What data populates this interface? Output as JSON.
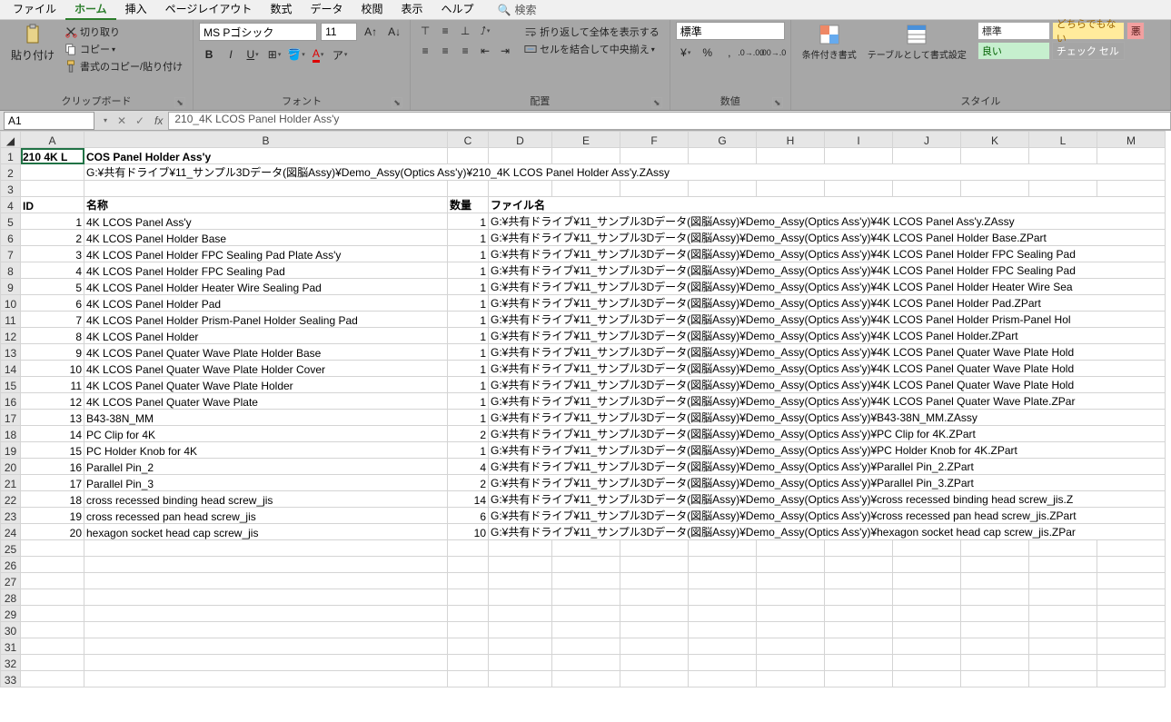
{
  "menu": {
    "items": [
      "ファイル",
      "ホーム",
      "挿入",
      "ページレイアウト",
      "数式",
      "データ",
      "校閲",
      "表示",
      "ヘルプ"
    ],
    "active": 1,
    "search_icon": "🔍",
    "search_label": "検索"
  },
  "ribbon": {
    "clipboard": {
      "label": "クリップボード",
      "paste": "貼り付け",
      "cut": "切り取り",
      "copy": "コピー",
      "format_painter": "書式のコピー/貼り付け"
    },
    "font": {
      "label": "フォント",
      "name": "MS Pゴシック",
      "size": "11"
    },
    "alignment": {
      "label": "配置",
      "wrap": "折り返して全体を表示する",
      "merge": "セルを結合して中央揃え"
    },
    "number": {
      "label": "数値",
      "format": "標準"
    },
    "styles": {
      "label": "スタイル",
      "cond_fmt": "条件付き書式",
      "table_fmt": "テーブルとして書式設定",
      "normal": "標準",
      "neutral": "どちらでもない",
      "good": "良い",
      "check": "チェック セル",
      "bad": "悪"
    }
  },
  "formula_bar": {
    "cell_ref": "A1",
    "formula": "210_4K LCOS Panel Holder Ass'y"
  },
  "sheet": {
    "col_headers": [
      "A",
      "B",
      "C",
      "D",
      "E",
      "F",
      "G",
      "H",
      "I",
      "J",
      "K",
      "L",
      "M"
    ],
    "title_row": {
      "a": "210 4K L",
      "b_spill": "COS Panel Holder Ass'y"
    },
    "path_row": "G:¥共有ドライブ¥11_サンプル3Dデータ(図脳Assy)¥Demo_Assy(Optics Ass'y)¥210_4K LCOS Panel Holder Ass'y.ZAssy",
    "header_row": {
      "id": "ID",
      "name": "名称",
      "qty": "数量",
      "file": "ファイル名"
    },
    "path_prefix": "G:¥共有ドライブ¥11_サンプル3Dデータ(図脳Assy)¥Demo_Assy(Optics Ass'y)¥",
    "rows": [
      {
        "id": 1,
        "name": "4K LCOS Panel Ass'y",
        "qty": 1,
        "file": "4K LCOS Panel Ass'y.ZAssy"
      },
      {
        "id": 2,
        "name": "4K LCOS Panel Holder Base",
        "qty": 1,
        "file": "4K LCOS Panel Holder Base.ZPart"
      },
      {
        "id": 3,
        "name": "4K LCOS Panel Holder FPC Sealing Pad Plate Ass'y",
        "qty": 1,
        "file": "4K LCOS Panel Holder FPC Sealing Pad"
      },
      {
        "id": 4,
        "name": "4K LCOS Panel Holder FPC Sealing Pad",
        "qty": 1,
        "file": "4K LCOS Panel Holder FPC Sealing Pad"
      },
      {
        "id": 5,
        "name": "4K LCOS Panel Holder Heater Wire Sealing Pad",
        "qty": 1,
        "file": "4K LCOS Panel Holder Heater Wire Sea"
      },
      {
        "id": 6,
        "name": "4K LCOS Panel Holder Pad",
        "qty": 1,
        "file": "4K LCOS Panel Holder Pad.ZPart"
      },
      {
        "id": 7,
        "name": "4K LCOS Panel Holder Prism-Panel Holder Sealing Pad",
        "qty": 1,
        "file": "4K LCOS Panel Holder Prism-Panel Hol"
      },
      {
        "id": 8,
        "name": "4K LCOS Panel Holder",
        "qty": 1,
        "file": "4K LCOS Panel Holder.ZPart"
      },
      {
        "id": 9,
        "name": "4K LCOS Panel Quater Wave Plate Holder Base",
        "qty": 1,
        "file": "4K LCOS Panel Quater Wave Plate Hold"
      },
      {
        "id": 10,
        "name": "4K LCOS Panel Quater Wave Plate Holder Cover",
        "qty": 1,
        "file": "4K LCOS Panel Quater Wave Plate Hold"
      },
      {
        "id": 11,
        "name": "4K LCOS Panel Quater Wave Plate Holder",
        "qty": 1,
        "file": "4K LCOS Panel Quater Wave Plate Hold"
      },
      {
        "id": 12,
        "name": "4K LCOS Panel Quater Wave Plate",
        "qty": 1,
        "file": "4K LCOS Panel Quater Wave Plate.ZPar"
      },
      {
        "id": 13,
        "name": "B43-38N_MM",
        "qty": 1,
        "file": "B43-38N_MM.ZAssy"
      },
      {
        "id": 14,
        "name": "PC Clip for 4K",
        "qty": 2,
        "file": "PC Clip for 4K.ZPart"
      },
      {
        "id": 15,
        "name": "PC Holder Knob for 4K",
        "qty": 1,
        "file": "PC Holder Knob for 4K.ZPart"
      },
      {
        "id": 16,
        "name": "Parallel Pin_2",
        "qty": 4,
        "file": "Parallel Pin_2.ZPart"
      },
      {
        "id": 17,
        "name": "Parallel Pin_3",
        "qty": 2,
        "file": "Parallel Pin_3.ZPart"
      },
      {
        "id": 18,
        "name": "cross recessed binding head screw_jis",
        "qty": 14,
        "file": "cross recessed binding head screw_jis.Z"
      },
      {
        "id": 19,
        "name": "cross recessed pan head screw_jis",
        "qty": 6,
        "file": "cross recessed pan head screw_jis.ZPart"
      },
      {
        "id": 20,
        "name": "hexagon socket head cap screw_jis",
        "qty": 10,
        "file": "hexagon socket head cap screw_jis.ZPar"
      }
    ],
    "empty_rows": [
      25,
      26,
      27,
      28,
      29,
      30,
      31,
      32,
      33
    ]
  }
}
